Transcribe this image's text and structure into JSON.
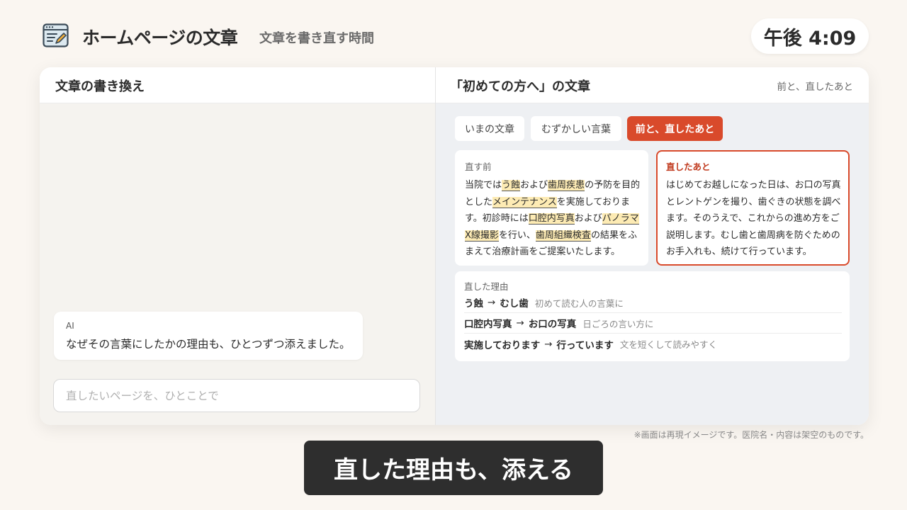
{
  "header": {
    "app_icon": "document-edit-icon",
    "title": "ホームページの文章",
    "subtitle": "文章を書き直す時間",
    "clock": "午後 4:09"
  },
  "left_pane": {
    "title": "文章の書き換え",
    "ai_message": {
      "sender": "AI",
      "text": "なぜその言葉にしたかの理由も、ひとつずつ添えました。"
    },
    "input_placeholder": "直したいページを、ひとことで"
  },
  "right_pane": {
    "title": "「初めての方へ」の文章",
    "mode_label": "前と、直したあと",
    "tabs": [
      {
        "label": "いまの文章",
        "active": false
      },
      {
        "label": "むずかしい言葉",
        "active": false
      },
      {
        "label": "前と、直したあと",
        "active": true
      }
    ],
    "before": {
      "label": "直す前",
      "segments": [
        {
          "t": "当院では",
          "hl": false
        },
        {
          "t": "う蝕",
          "hl": true
        },
        {
          "t": "および",
          "hl": false
        },
        {
          "t": "歯周疾患",
          "hl": true
        },
        {
          "t": "の予防を目的とした",
          "hl": false
        },
        {
          "t": "メインテナンス",
          "hl": true
        },
        {
          "t": "を実施しております。初診時には",
          "hl": false
        },
        {
          "t": "口腔内写真",
          "hl": true
        },
        {
          "t": "および",
          "hl": false
        },
        {
          "t": "パノラマX線撮影",
          "hl": true
        },
        {
          "t": "を行い、",
          "hl": false
        },
        {
          "t": "歯周組織検査",
          "hl": true
        },
        {
          "t": "の結果をふまえて治療計画をご提案いたします。",
          "hl": false
        }
      ]
    },
    "after": {
      "label": "直したあと",
      "text": "はじめてお越しになった日は、お口の写真とレントゲンを撮り、歯ぐきの状態を調べます。そのうえで、これからの進め方をご説明します。むし歯と歯周病を防ぐためのお手入れも、続けて行っています。"
    },
    "reasons": {
      "title": "直した理由",
      "items": [
        {
          "from": "う蝕",
          "arrow": "→",
          "to": "むし歯",
          "note": "初めて読む人の言葉に"
        },
        {
          "from": "口腔内写真",
          "arrow": "→",
          "to": "お口の写真",
          "note": "日ごろの言い方に"
        },
        {
          "from": "実施しております",
          "arrow": "→",
          "to": "行っています",
          "note": "文を短くして読みやすく"
        }
      ]
    }
  },
  "colors": {
    "accent": "#d94a2b",
    "highlight": "#fdebb4",
    "background": "#faf6f1",
    "caption_bg": "#2e2e2e"
  },
  "disclaimer": "※画面は再現イメージです。医院名・内容は架空のものです。",
  "caption": "直した理由も、添える"
}
